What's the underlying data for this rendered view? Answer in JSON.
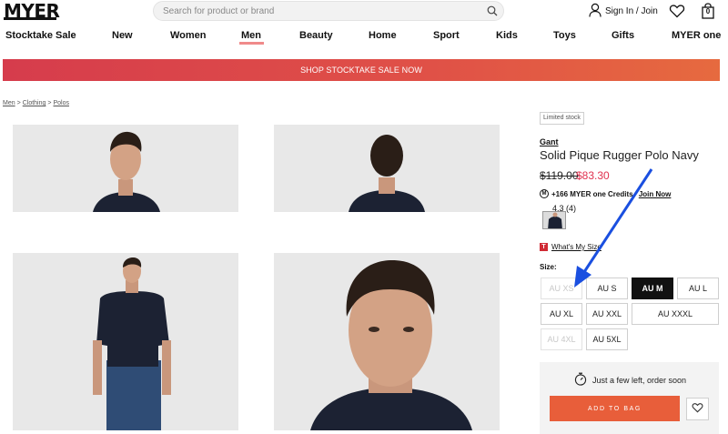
{
  "header": {
    "logo": "MYER",
    "search_placeholder": "Search for product or brand",
    "signin_label": "Sign In / Join",
    "bag_count": "0"
  },
  "nav": {
    "items": [
      "Stocktake Sale",
      "New",
      "Women",
      "Men",
      "Beauty",
      "Home",
      "Sport",
      "Kids",
      "Toys",
      "Gifts",
      "MYER one"
    ],
    "active": "Men"
  },
  "banner": {
    "text": "SHOP STOCKTAKE SALE NOW"
  },
  "breadcrumb": {
    "items": [
      "Men",
      "Clothing",
      "Polos"
    ],
    "separator": ">"
  },
  "product": {
    "badge": "Limited stock",
    "brand": "Gant",
    "title": "Solid Pique Rugger Polo Navy",
    "price_was": "$119.00",
    "price_now": "$83.30",
    "credits_text": "+166 MYER one Credits.",
    "credits_link": "Join Now",
    "rating": "4.3 (4)",
    "size_guide": "What's My Size",
    "size_label": "Size:",
    "sizes": [
      {
        "label": "AU XS",
        "state": "disabled"
      },
      {
        "label": "AU S",
        "state": "available"
      },
      {
        "label": "AU M",
        "state": "selected"
      },
      {
        "label": "AU L",
        "state": "available"
      },
      {
        "label": "AU XL",
        "state": "available"
      },
      {
        "label": "AU XXL",
        "state": "available"
      },
      {
        "label": "AU XXXL",
        "state": "available"
      },
      {
        "label": "AU 4XL",
        "state": "disabled"
      },
      {
        "label": "AU 5XL",
        "state": "available"
      }
    ],
    "stock_message": "Just a few left, order soon",
    "add_to_bag": "ADD TO BAG"
  },
  "colors": {
    "accent_red": "#e0314f",
    "banner_start": "#d63c4c",
    "banner_end": "#e66a3f",
    "add_to_bag": "#e85e3a",
    "annotation_arrow": "#1a4fe0",
    "nav_underline": "#f08a8a"
  },
  "icons": [
    "search-icon",
    "user-icon",
    "heart-icon",
    "bag-icon",
    "credits-icon",
    "timer-icon",
    "wishlist-heart-icon"
  ]
}
